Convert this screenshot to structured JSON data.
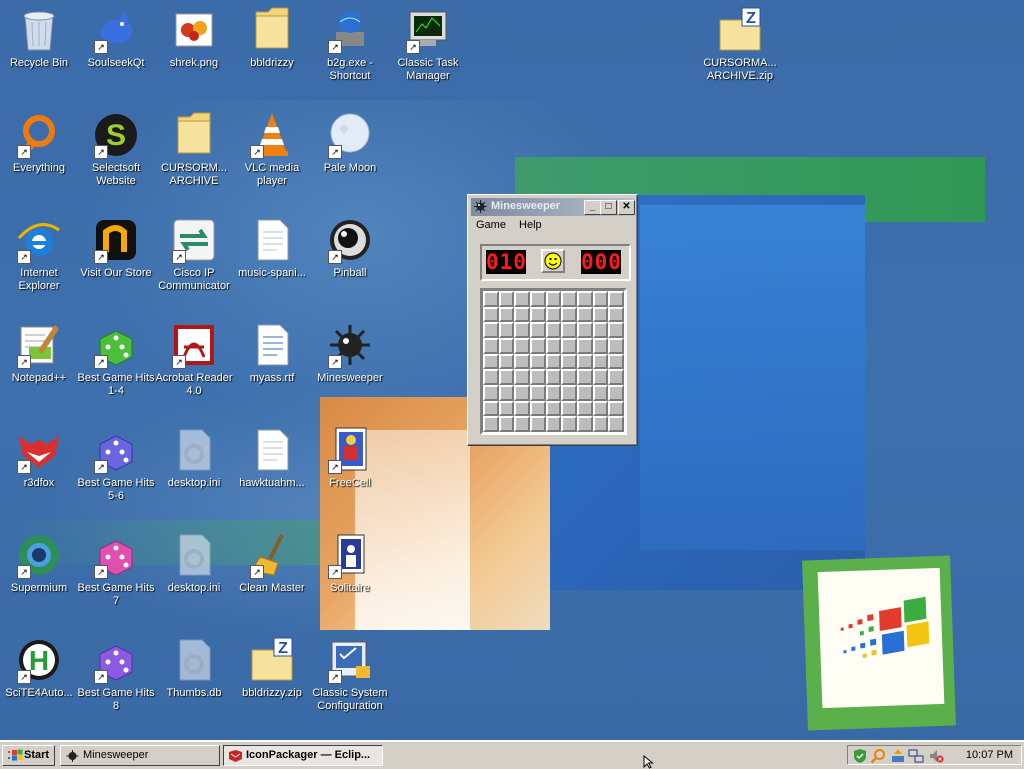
{
  "desktop": {
    "icons": [
      {
        "label": "Recycle Bin",
        "icon": "recycle-bin-icon"
      },
      {
        "label": "SoulseekQt",
        "icon": "bird-icon"
      },
      {
        "label": "shrek.png",
        "icon": "image-file-icon"
      },
      {
        "label": "bbldrizzy",
        "icon": "folder-icon"
      },
      {
        "label": "b2g.exe - Shortcut",
        "icon": "globe-exe-icon"
      },
      {
        "label": "Classic Task Manager",
        "icon": "task-manager-icon"
      },
      {
        "label": "CURSORMA... ARCHIVE.zip",
        "icon": "zip-folder-icon"
      },
      {
        "label": "Everything",
        "icon": "everything-search-icon"
      },
      {
        "label": "Selectsoft Website",
        "icon": "selectsoft-s-icon"
      },
      {
        "label": "CURSORM... ARCHIVE",
        "icon": "folder-icon"
      },
      {
        "label": "VLC media player",
        "icon": "vlc-cone-icon"
      },
      {
        "label": "Pale Moon",
        "icon": "moon-icon"
      },
      {
        "label": "Internet Explorer",
        "icon": "internet-explorer-icon"
      },
      {
        "label": "Visit Our Store",
        "icon": "store-n-icon"
      },
      {
        "label": "Cisco IP Communicator",
        "icon": "cisco-arrows-icon"
      },
      {
        "label": "music-spani...",
        "icon": "text-file-icon"
      },
      {
        "label": "Pinball",
        "icon": "pinball-icon"
      },
      {
        "label": "Notepad++",
        "icon": "notepadpp-icon"
      },
      {
        "label": "Best Game Hits 1-4",
        "icon": "green-dice-icon"
      },
      {
        "label": "Acrobat Reader 4.0",
        "icon": "acrobat-icon"
      },
      {
        "label": "myass.rtf",
        "icon": "rtf-file-icon"
      },
      {
        "label": "Minesweeper",
        "icon": "mine-icon"
      },
      {
        "label": "r3dfox",
        "icon": "red-fox-icon"
      },
      {
        "label": "Best Game Hits 5-6",
        "icon": "blue-dice-icon"
      },
      {
        "label": "desktop.ini",
        "icon": "settings-file-icon"
      },
      {
        "label": "hawktuahm...",
        "icon": "text-file-icon"
      },
      {
        "label": "FreeCell",
        "icon": "freecell-card-icon"
      },
      {
        "label": "Supermium",
        "icon": "supermium-icon"
      },
      {
        "label": "Best Game Hits 7",
        "icon": "pink-dice-icon"
      },
      {
        "label": "desktop.ini",
        "icon": "settings-file-icon"
      },
      {
        "label": "Clean Master",
        "icon": "broom-icon"
      },
      {
        "label": "Solitaire",
        "icon": "solitaire-card-icon"
      },
      {
        "label": "SciTE4Auto...",
        "icon": "scite-h-icon"
      },
      {
        "label": "Best Game Hits 8",
        "icon": "purple-dice-icon"
      },
      {
        "label": "Thumbs.db",
        "icon": "settings-file-icon"
      },
      {
        "label": "bbldrizzy.zip",
        "icon": "zip-folder-icon"
      },
      {
        "label": "Classic System Configuration",
        "icon": "system-config-icon"
      }
    ]
  },
  "minesweeper": {
    "title": "Minesweeper",
    "menu": [
      "Game",
      "Help"
    ],
    "mine_counter": "010",
    "timer": "000",
    "face": "smiley-icon",
    "rows": 9,
    "cols": 9,
    "minimize": "_",
    "maximize": "□",
    "close": "✕"
  },
  "taskbar": {
    "start_label": "Start",
    "tasks": [
      {
        "label": "Minesweeper",
        "active": false
      },
      {
        "label": "IconPackager — Eclip...",
        "active": true
      }
    ],
    "tray_icons": [
      "security-shield-icon",
      "search-icon",
      "network-update-icon",
      "network-icon",
      "volume-muted-icon"
    ],
    "clock": "10:07 PM"
  },
  "colors": {
    "desktop_blue": "#3a6ea5",
    "led_red": "#ff1a1a",
    "face_yellow": "#ffff00",
    "title_gray": "#7b8ba0"
  }
}
